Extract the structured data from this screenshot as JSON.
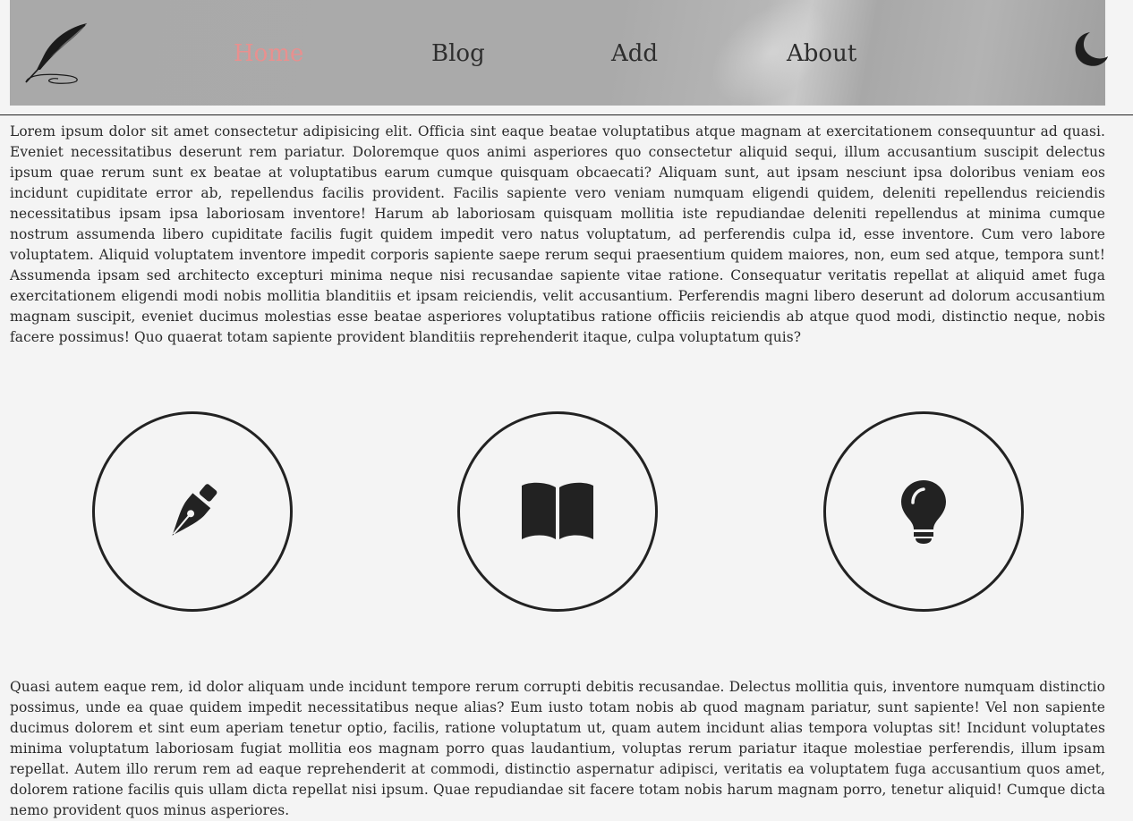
{
  "header": {
    "logo_icon": "quill-feather-icon",
    "nav": [
      {
        "label": "Home",
        "active": true
      },
      {
        "label": "Blog",
        "active": false
      },
      {
        "label": "Add",
        "active": false
      },
      {
        "label": "About",
        "active": false
      }
    ],
    "theme_toggle_icon": "moon-icon",
    "active_color": "#e8908f"
  },
  "content": {
    "paragraph_1": "Lorem ipsum dolor sit amet consectetur adipisicing elit. Officia sint eaque beatae voluptatibus atque magnam at exercitationem consequuntur ad quasi. Eveniet necessitatibus deserunt rem pariatur. Doloremque quos animi asperiores quo consectetur aliquid sequi, illum accusantium suscipit delectus ipsum quae rerum sunt ex beatae at voluptatibus earum cumque quisquam obcaecati? Aliquam sunt, aut ipsam nesciunt ipsa doloribus veniam eos incidunt cupiditate error ab, repellendus facilis provident. Facilis sapiente vero veniam numquam eligendi quidem, deleniti repellendus reiciendis necessitatibus ipsam ipsa laboriosam inventore! Harum ab laboriosam quisquam mollitia iste repudiandae deleniti repellendus at minima cumque nostrum assumenda libero cupiditate facilis fugit quidem impedit vero natus voluptatum, ad perferendis culpa id, esse inventore. Cum vero labore voluptatem. Aliquid voluptatem inventore impedit corporis sapiente saepe rerum sequi praesentium quidem maiores, non, eum sed atque, tempora sunt! Assumenda ipsam sed architecto excepturi minima neque nisi recusandae sapiente vitae ratione. Consequatur veritatis repellat at aliquid amet fuga exercitationem eligendi modi nobis mollitia blanditiis et ipsam reiciendis, velit accusantium. Perferendis magni libero deserunt ad dolorum accusantium magnam suscipit, eveniet ducimus molestias esse beatae asperiores voluptatibus ratione officiis reiciendis ab atque quod modi, distinctio neque, nobis facere possimus! Quo quaerat totam sapiente provident blanditiis reprehenderit itaque, culpa voluptatum quis?",
    "features": [
      {
        "icon": "fountain-pen-icon"
      },
      {
        "icon": "open-book-icon"
      },
      {
        "icon": "lightbulb-icon"
      }
    ],
    "paragraph_2": "Quasi autem eaque rem, id dolor aliquam unde incidunt tempore rerum corrupti debitis recusandae. Delectus mollitia quis, inventore numquam distinctio possimus, unde ea quae quidem impedit necessitatibus neque alias? Eum iusto totam nobis ab quod magnam pariatur, sunt sapiente! Vel non sapiente ducimus dolorem et sint eum aperiam tenetur optio, facilis, ratione voluptatum ut, quam autem incidunt alias tempora voluptas sit! Incidunt voluptates minima voluptatum laboriosam fugiat mollitia eos magnam porro quas laudantium, voluptas rerum pariatur itaque molestiae perferendis, illum ipsam repellat. Autem illo rerum rem ad eaque reprehenderit at commodi, distinctio aspernatur adipisci, veritatis ea voluptatem fuga accusantium quos amet, dolorem ratione facilis quis ullam dicta repellat nisi ipsum. Quae repudiandae sit facere totam nobis harum magnam porro, tenetur aliquid! Cumque dicta nemo provident quos minus asperiores."
  }
}
